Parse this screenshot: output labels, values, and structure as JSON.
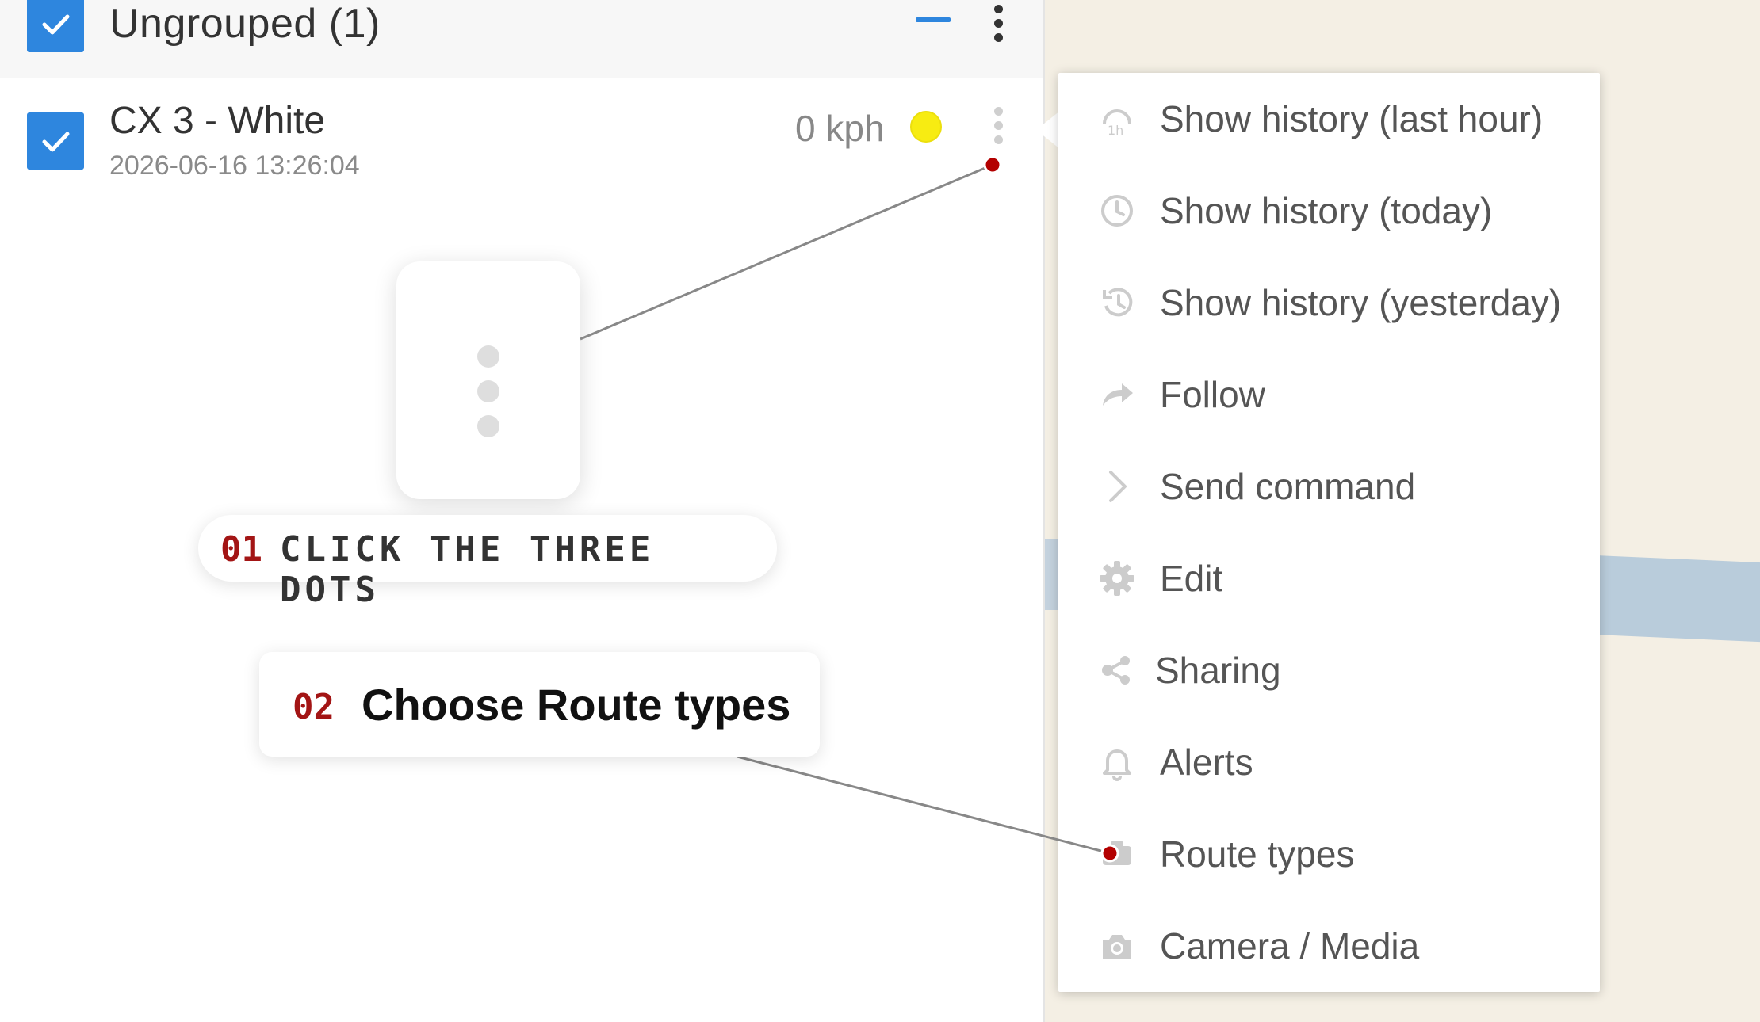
{
  "group": {
    "title": "Ungrouped (1)",
    "checked": true
  },
  "device": {
    "name": "CX 3 - White",
    "timestamp": "2026-06-16 13:26:04",
    "speed": "0 kph",
    "status_color": "#f7ec12",
    "checked": true
  },
  "menu": {
    "items": [
      {
        "label": "Show history (last hour)",
        "icon": "history-1h-icon"
      },
      {
        "label": "Show history (today)",
        "icon": "clock-icon"
      },
      {
        "label": "Show history (yesterday)",
        "icon": "history-back-icon"
      },
      {
        "label": "Follow",
        "icon": "share-arrow-icon"
      },
      {
        "label": "Send command",
        "icon": "chevron-right-icon"
      },
      {
        "label": "Edit",
        "icon": "gear-icon"
      },
      {
        "label": "Sharing",
        "icon": "share-nodes-icon"
      },
      {
        "label": "Alerts",
        "icon": "bell-icon"
      },
      {
        "label": "Route types",
        "icon": "route-types-icon"
      },
      {
        "label": "Camera / Media",
        "icon": "camera-icon"
      }
    ]
  },
  "annotations": {
    "step1": {
      "number": "01",
      "text": "CLICK THE THREE DOTS"
    },
    "step2": {
      "number": "02",
      "text": "Choose Route types"
    }
  },
  "colors": {
    "accent": "#2e86de",
    "annotation_red": "#a31515",
    "map_background": "#f4efe4"
  }
}
